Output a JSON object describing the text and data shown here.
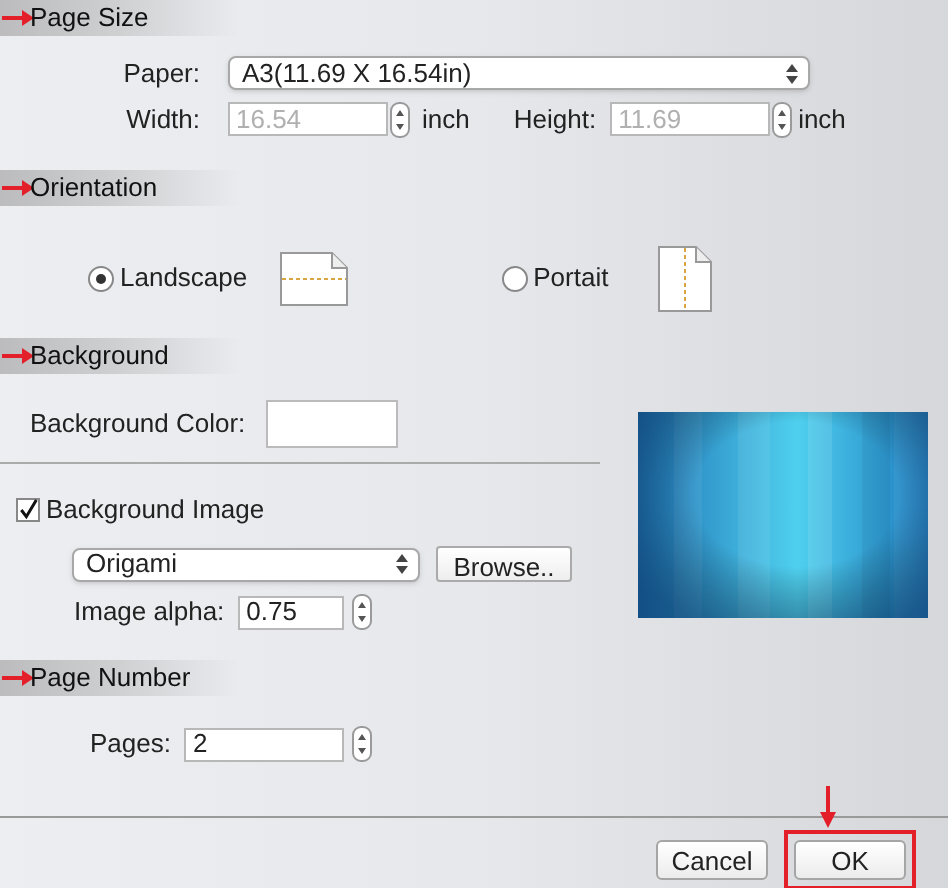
{
  "page_size": {
    "title": "Page Size",
    "paper": {
      "label": "Paper:",
      "value": "A3(11.69 X 16.54in)"
    },
    "width": {
      "label": "Width:",
      "value": "16.54",
      "unit": "inch",
      "disabled": true
    },
    "height": {
      "label": "Height:",
      "value": "11.69",
      "unit": "inch",
      "disabled": true
    }
  },
  "orientation": {
    "title": "Orientation",
    "options": [
      {
        "label": "Landscape",
        "kind": "landscape",
        "selected": true
      },
      {
        "label": "Portait",
        "kind": "portrait",
        "selected": false
      }
    ]
  },
  "background": {
    "title": "Background",
    "color_label": "Background Color:",
    "image": {
      "label": "Background Image",
      "checked": true
    },
    "image_select": {
      "value": "Origami"
    },
    "browse": "Browse..",
    "alpha": {
      "label": "Image alpha:",
      "value": "0.75"
    }
  },
  "page_number": {
    "title": "Page Number",
    "pages": {
      "label": "Pages:",
      "value": "2"
    }
  },
  "buttons": [
    {
      "label": "Cancel",
      "highlighted": false
    },
    {
      "label": "OK",
      "highlighted": true
    }
  ]
}
